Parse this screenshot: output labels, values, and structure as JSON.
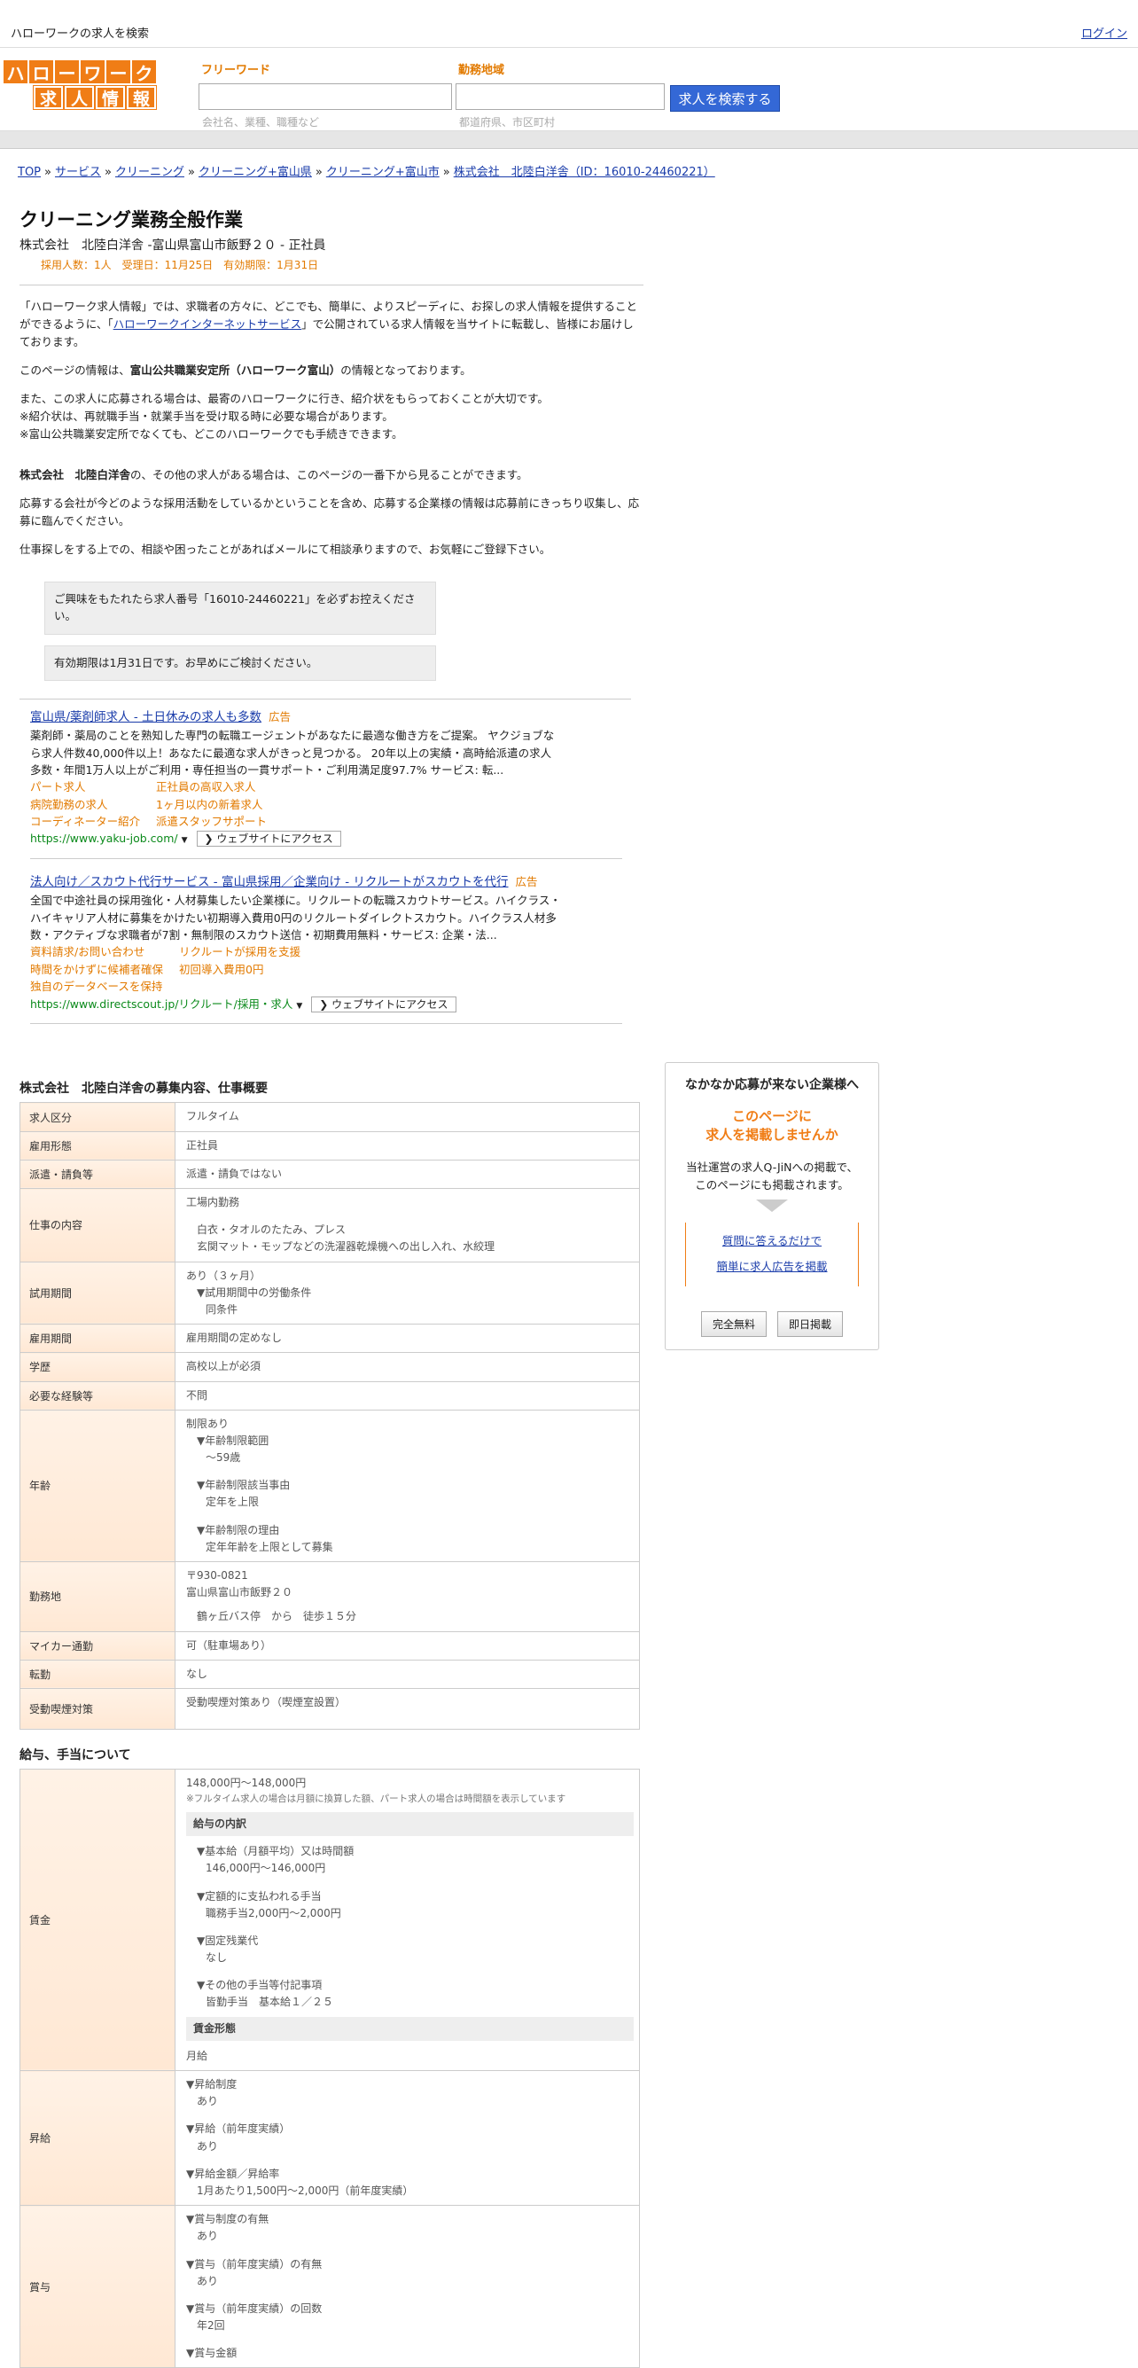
{
  "header": {
    "site_title": "ハローワークの求人を検索",
    "login": "ログイン",
    "logo_row1": [
      "ハ",
      "ロ",
      "ー",
      "ワ",
      "ー",
      "ク"
    ],
    "logo_row2": [
      "求",
      "人",
      "情",
      "報"
    ]
  },
  "search": {
    "free_word_label": "フリーワード",
    "free_word_hint": "会社名、業種、職種など",
    "location_label": "勤務地域",
    "location_hint": "都道府県、市区町村",
    "button": "求人を検索する"
  },
  "breadcrumb": [
    "TOP",
    "サービス",
    "クリーニング",
    "クリーニング+富山県",
    "クリーニング+富山市",
    "株式会社　北陸白洋舎（ID：16010-24460221）"
  ],
  "job": {
    "title": "クリーニング業務全般作業",
    "company_line": "株式会社　北陸白洋舎 -富山県富山市飯野２０ - 正社員",
    "meta": "採用人数：1人　受理日：11月25日　有効期限：1月31日"
  },
  "intro": {
    "p1a": "「ハローワーク求人情報」では、求職者の方々に、どこでも、簡単に、よりスピーディに、お探しの求人情報を提供することができるように、「",
    "p1link": "ハローワークインターネットサービス",
    "p1b": "」で公開されている求人情報を当サイトに転載し、皆様にお届けしております。",
    "p2a": "このページの情報は、",
    "p2b": "富山公共職業安定所（ハローワーク富山）",
    "p2c": "の情報となっております。",
    "p3_1": "また、この求人に応募される場合は、最寄のハローワークに行き、紹介状をもらっておくことが大切です。",
    "p3_2": "※紹介状は、再就職手当・就業手当を受け取る時に必要な場合があります。",
    "p3_3": "※富山公共職業安定所でなくても、どこのハローワークでも手続きできます。",
    "p4a": "株式会社　北陸白洋舎",
    "p4b": "の、その他の求人がある場合は、このページの一番下から見ることができます。",
    "p5": "応募する会社が今どのような採用活動をしているかということを含め、応募する企業様の情報は応募前にきっちり収集し、応募に臨んでください。",
    "p6": "仕事探しをする上での、相談や困ったことがあればメールにて相談承りますので、お気軽にご登録下さい。",
    "box1": "ご興味をもたれたら求人番号「16010-24460221」を必ずお控えください。",
    "box2": "有効期限は1月31日です。お早めにご検討ください。"
  },
  "ads": [
    {
      "title": "富山県/薬剤師求人 - 土日休みの求人も多数",
      "tag": "広告",
      "body": "薬剤師・薬局のことを熟知した専門の転職エージェントがあなたに最適な働き方をご提案。 ヤクジョブなら求人件数40,000件以上！あなたに最適な求人がきっと見つかる。 20年以上の実績・高時給派遣の求人多数・年間1万人以上がご利用・専任担当の一貫サポート・ご利用満足度97.7% サービス: 転...",
      "links": [
        "パート求人",
        "正社員の高収入求人",
        "病院勤務の求人",
        "1ヶ月以内の新着求人",
        "コーディネーター紹介",
        "派遣スタッフサポート"
      ],
      "url": "https://www.yaku-job.com/",
      "visit": "ウェブサイトにアクセス"
    },
    {
      "title": "法人向け／スカウト代行サービス - 富山県採用／企業向け - リクルートがスカウトを代行",
      "tag": "広告",
      "body": "全国で中途社員の採用強化・人材募集したい企業様に。リクルートの転職スカウトサービス。ハイクラス・ハイキャリア人材に募集をかけたい初期導入費用0円のリクルートダイレクトスカウト。ハイクラス人材多数・アクティブな求職者が7割・無制限のスカウト送信・初期費用無料・サービス: 企業・法...",
      "links": [
        "資料請求/お問い合わせ",
        "リクルートが採用を支援",
        "時間をかけずに候補者確保",
        "初回導入費用0円",
        "独自のデータベースを保持",
        ""
      ],
      "url": "https://www.directscout.jp/リクルート/採用・求人",
      "visit": "ウェブサイトにアクセス"
    }
  ],
  "details": {
    "heading": "株式会社　北陸白洋舎の募集内容、仕事概要",
    "rows": {
      "kubun": {
        "label": "求人区分",
        "value": "フルタイム"
      },
      "koyou": {
        "label": "雇用形態",
        "value": "正社員"
      },
      "haken": {
        "label": "派遣・請負等",
        "value": "派遣・請負ではない"
      },
      "naiyou": {
        "label": "仕事の内容",
        "v1": "工場内勤務",
        "v2": "白衣・タオルのたたみ、プレス",
        "v3": "玄関マット・モップなどの洗濯器乾燥機への出し入れ、水絞理"
      },
      "shiyou": {
        "label": "試用期間",
        "v1": "あり（３ヶ月）",
        "v2": "▼試用期間中の労働条件",
        "v3": "同条件"
      },
      "kikan": {
        "label": "雇用期間",
        "value": "雇用期間の定めなし"
      },
      "gakureki": {
        "label": "学歴",
        "value": "高校以上が必須"
      },
      "keiken": {
        "label": "必要な経験等",
        "value": "不問"
      },
      "nenrei": {
        "label": "年齢",
        "v1": "制限あり",
        "v2": "▼年齢制限範囲",
        "v3": "〜59歳",
        "v4": "▼年齢制限該当事由",
        "v5": "定年を上限",
        "v6": "▼年齢制限の理由",
        "v7": "定年年齢を上限として募集"
      },
      "kinmu": {
        "label": "勤務地",
        "v1": "〒930-0821",
        "v2": "富山県富山市飯野２０",
        "v3": "鶴ヶ丘バス停　から　徒歩１５分"
      },
      "mycar": {
        "label": "マイカー通勤",
        "value": "可（駐車場あり）"
      },
      "tenkin": {
        "label": "転勤",
        "value": "なし"
      },
      "judou": {
        "label": "受動喫煙対策",
        "value": "受動喫煙対策あり（喫煙室設置）"
      }
    }
  },
  "salary": {
    "heading": "給与、手当について",
    "chingin": {
      "label": "賃金",
      "range": "148,000円〜148,000円",
      "note": "※フルタイム求人の場合は月額に換算した額、パート求人の場合は時間額を表示しています",
      "sub1": "給与の内訳",
      "a1": "▼基本給（月額平均）又は時間額",
      "a2": "146,000円〜146,000円",
      "b1": "▼定額的に支払われる手当",
      "b2": "職務手当2,000円〜2,000円",
      "c1": "▼固定残業代",
      "c2": "なし",
      "d1": "▼その他の手当等付記事項",
      "d2": "皆勤手当　基本給１／２５",
      "sub2": "賃金形態",
      "keitai": "月給"
    },
    "shoukyu": {
      "label": "昇給",
      "a1": "▼昇給制度",
      "a2": "あり",
      "b1": "▼昇給（前年度実績）",
      "b2": "あり",
      "c1": "▼昇給金額／昇給率",
      "c2": "1月あたり1,500円〜2,000円（前年度実績）"
    },
    "shouyo": {
      "label": "賞与",
      "a1": "▼賞与制度の有無",
      "a2": "あり",
      "b1": "▼賞与（前年度実績）の有無",
      "b2": "あり",
      "c1": "▼賞与（前年度実績）の回数",
      "c2": "年2回",
      "d1": "▼賞与金額"
    }
  },
  "side": {
    "heading": "なかなか応募が来ない企業様へ",
    "orange1": "このページに",
    "orange2": "求人を掲載しませんか",
    "p1": "当社運営の求人Q-JiNへの掲載で、",
    "p2": "このページにも掲載されます。",
    "link1": "質問に答えるだけで",
    "link2": "簡単に求人広告を掲載",
    "btn1": "完全無料",
    "btn2": "即日掲載"
  }
}
